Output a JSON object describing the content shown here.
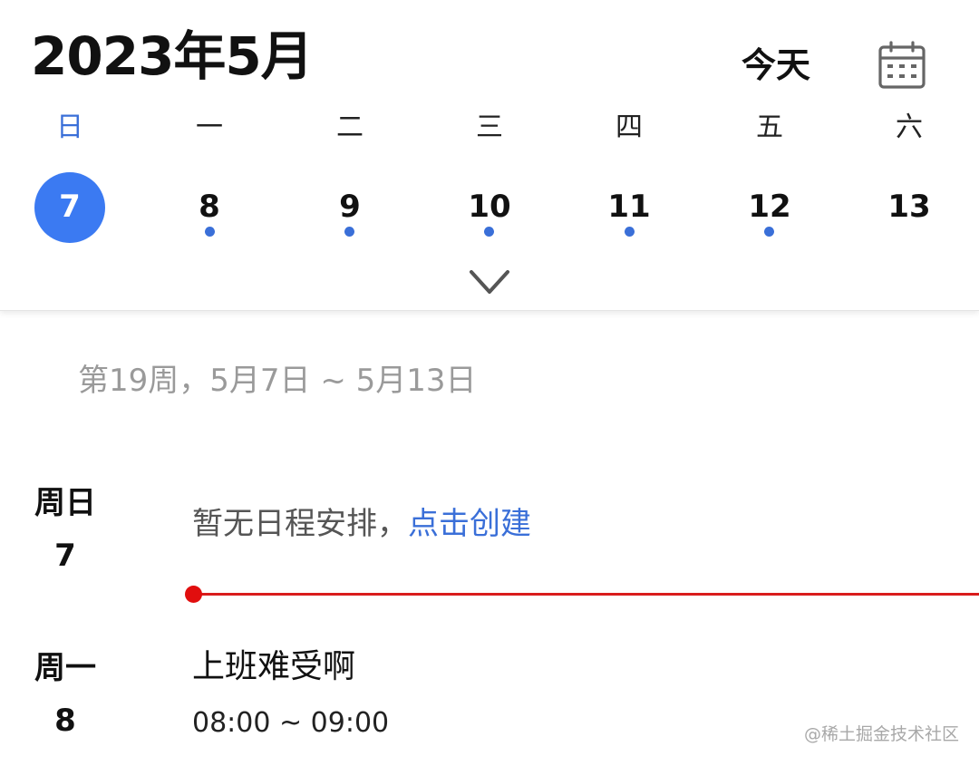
{
  "header": {
    "month_title": "2023年5月",
    "today_label": "今天",
    "calendar_icon": "calendar-icon",
    "expand_icon": "chevron-down-icon"
  },
  "weekdays": [
    "日",
    "一",
    "二",
    "三",
    "四",
    "五",
    "六"
  ],
  "dates": [
    {
      "num": "7",
      "selected": true,
      "has_event": false
    },
    {
      "num": "8",
      "selected": false,
      "has_event": true
    },
    {
      "num": "9",
      "selected": false,
      "has_event": true
    },
    {
      "num": "10",
      "selected": false,
      "has_event": true
    },
    {
      "num": "11",
      "selected": false,
      "has_event": true
    },
    {
      "num": "12",
      "selected": false,
      "has_event": true
    },
    {
      "num": "13",
      "selected": false,
      "has_event": false
    }
  ],
  "week_range": "第19周，5月7日 ~ 5月13日",
  "days": [
    {
      "weekday": "周日",
      "date": "7",
      "empty_text": "暂无日程安排，",
      "create_link": "点击创建"
    },
    {
      "weekday": "周一",
      "date": "8",
      "event_title": "上班难受啊",
      "event_time": "08:00 ~ 09:00"
    }
  ],
  "watermark": "@稀土掘金技术社区",
  "colors": {
    "accent": "#3b7af2",
    "link": "#3a6fd8",
    "now_line": "#d91c1c",
    "muted_text": "#9a9a9a"
  }
}
